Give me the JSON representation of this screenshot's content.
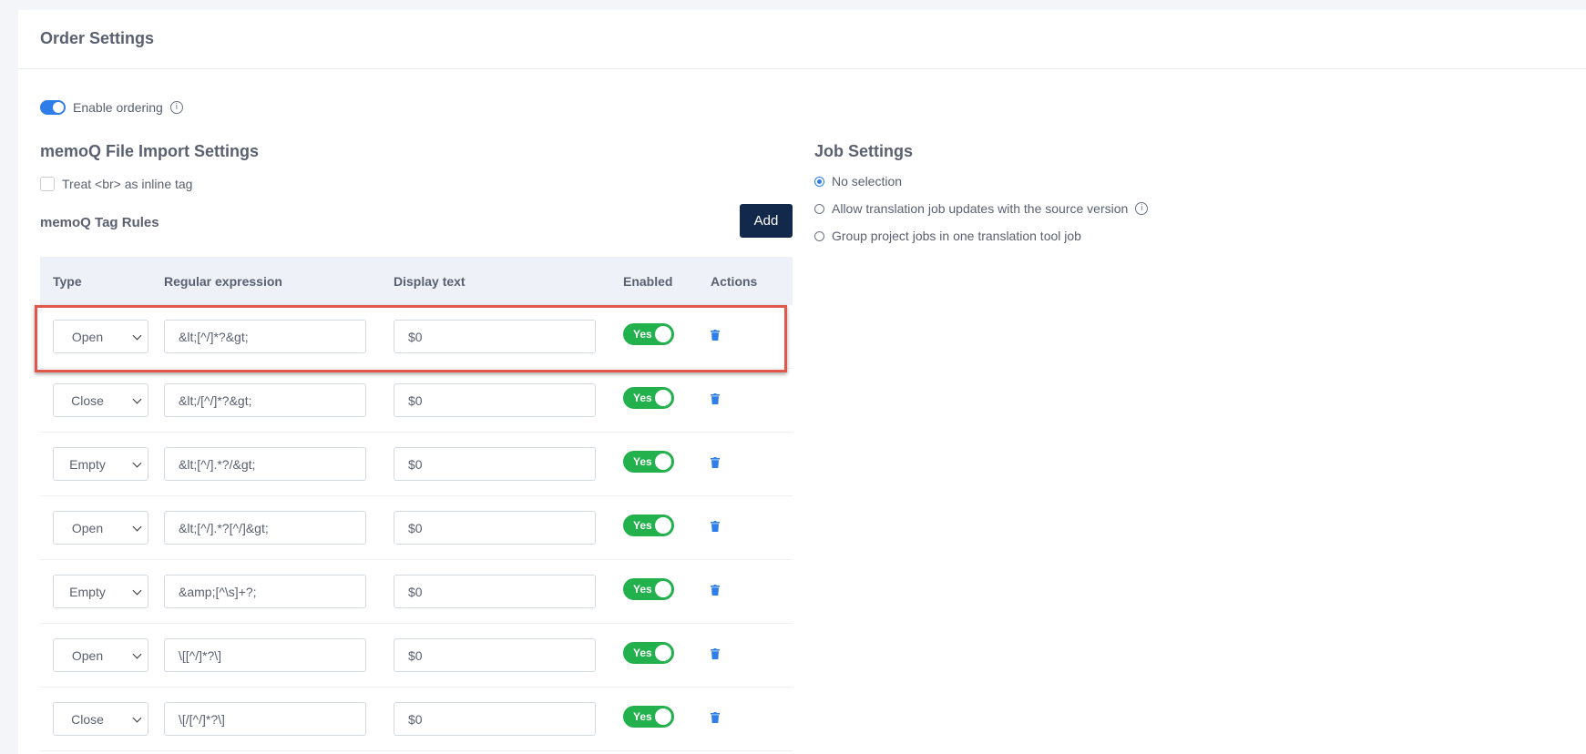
{
  "page": {
    "title": "Order Settings"
  },
  "ordering": {
    "label": "Enable ordering",
    "enabled": true,
    "info_icon": "info-icon"
  },
  "import_settings": {
    "title": "memoQ File Import Settings",
    "checkbox_label": "Treat <br> as inline tag",
    "checkbox_checked": false
  },
  "tag_rules": {
    "title": "memoQ Tag Rules",
    "add_label": "Add",
    "columns": [
      "Type",
      "Regular expression",
      "Display text",
      "Enabled",
      "Actions"
    ],
    "rows": [
      {
        "type": "Open",
        "regex": "&lt;[^/]*?&gt;",
        "display": "$0",
        "enabled": "Yes"
      },
      {
        "type": "Close",
        "regex": "&lt;/[^/]*?&gt;",
        "display": "$0",
        "enabled": "Yes"
      },
      {
        "type": "Empty",
        "regex": "&lt;[^/].*?/&gt;",
        "display": "$0",
        "enabled": "Yes"
      },
      {
        "type": "Open",
        "regex": "&lt;[^/].*?[^/]&gt;",
        "display": "$0",
        "enabled": "Yes"
      },
      {
        "type": "Empty",
        "regex": "&amp;[^\\s]+?;",
        "display": "$0",
        "enabled": "Yes"
      },
      {
        "type": "Open",
        "regex": "\\[[^/]*?\\]",
        "display": "$0",
        "enabled": "Yes"
      },
      {
        "type": "Close",
        "regex": "\\[/[^/]*?\\]",
        "display": "$0",
        "enabled": "Yes"
      }
    ]
  },
  "job_settings": {
    "title": "Job Settings",
    "options": [
      {
        "label": "No selection",
        "checked": true,
        "info": false
      },
      {
        "label": "Allow translation job updates with the source version",
        "checked": false,
        "info": true
      },
      {
        "label": "Group project jobs in one translation tool job",
        "checked": false,
        "info": false
      }
    ]
  },
  "colors": {
    "accent": "#2e7de9",
    "button_dark": "#13294b",
    "toggle_on": "#22b14c",
    "highlight_border": "#e2574c",
    "delete_icon": "#2e7de9"
  }
}
